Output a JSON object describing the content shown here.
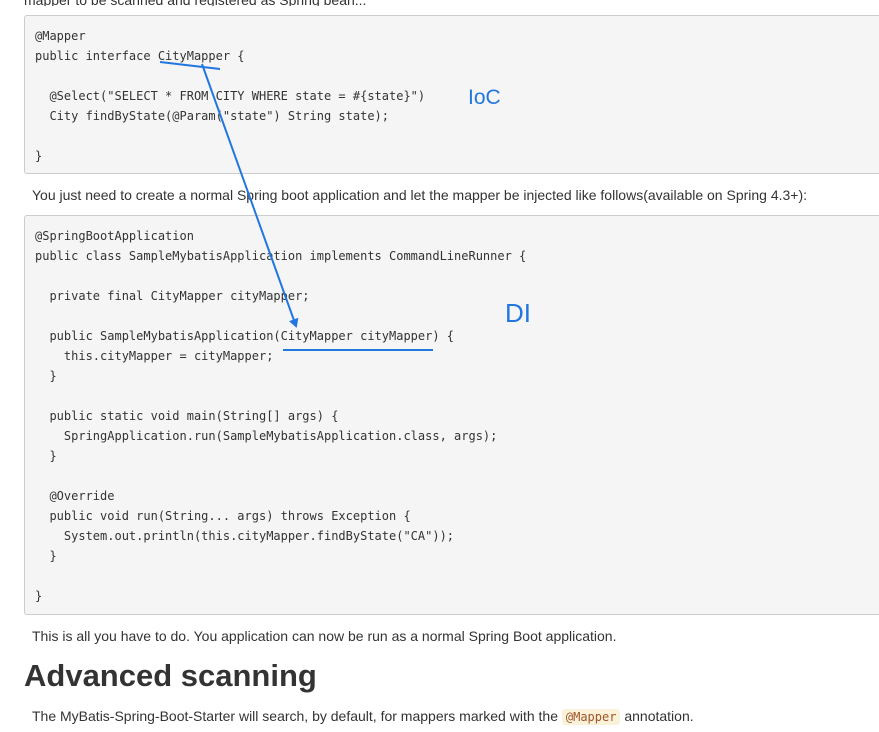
{
  "top_cut_text": "mapper to be scanned and registered as Spring bean...",
  "code_block_1": {
    "lines": [
      "@Mapper",
      "public interface CityMapper {",
      "",
      "  @Select(\"SELECT * FROM CITY WHERE state = #{state}\")",
      "  City findByState(@Param(\"state\") String state);",
      "",
      "}"
    ]
  },
  "paragraph_1": "You just need to create a normal Spring boot application and let the mapper be injected like follows(available on Spring 4.3+):",
  "code_block_2": {
    "lines": [
      "@SpringBootApplication",
      "public class SampleMybatisApplication implements CommandLineRunner {",
      "",
      "  private final CityMapper cityMapper;",
      "",
      "  public SampleMybatisApplication(CityMapper cityMapper) {",
      "    this.cityMapper = cityMapper;",
      "  }",
      "",
      "  public static void main(String[] args) {",
      "    SpringApplication.run(SampleMybatisApplication.class, args);",
      "  }",
      "",
      "  @Override",
      "  public void run(String... args) throws Exception {",
      "    System.out.println(this.cityMapper.findByState(\"CA\"));",
      "  }",
      "",
      "}"
    ]
  },
  "paragraph_2": "This is all you have to do. You application can now be run as a normal Spring Boot application.",
  "heading": "Advanced scanning",
  "paragraph_3": {
    "before": "The MyBatis-Spring-Boot-Starter will search, by default, for mappers marked with the ",
    "code": "@Mapper",
    "after": " annotation."
  },
  "annotations": {
    "ioc_label": "IoC",
    "di_label": "DI",
    "color": "#2176e0"
  }
}
